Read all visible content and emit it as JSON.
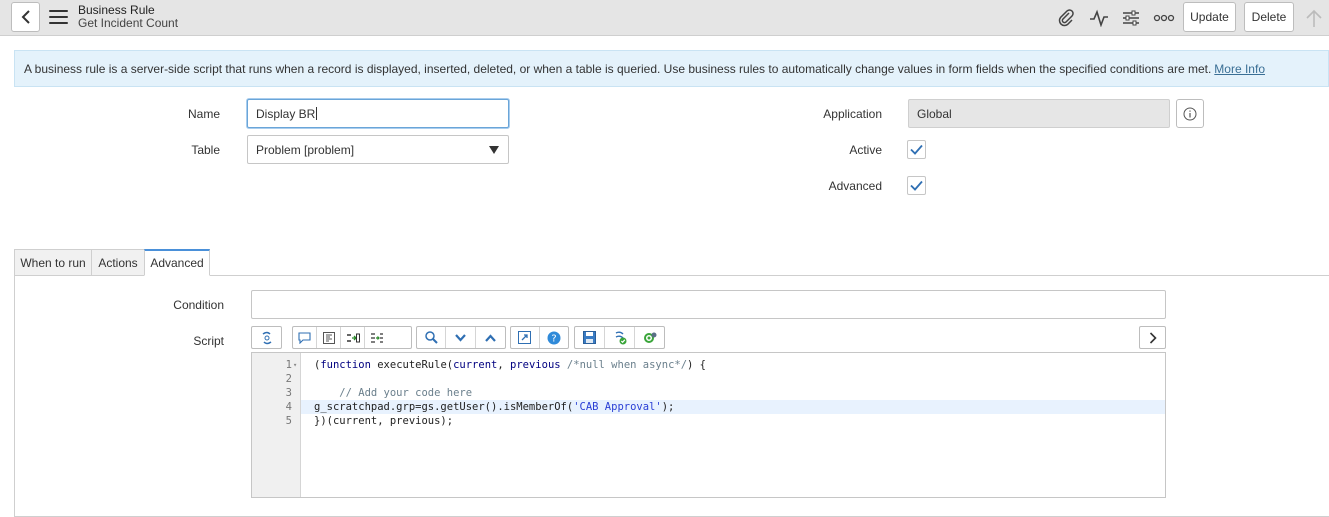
{
  "header": {
    "record_type": "Business Rule",
    "record_name": "Get Incident Count",
    "update_label": "Update",
    "delete_label": "Delete"
  },
  "banner": {
    "text": "A business rule is a server-side script that runs when a record is displayed, inserted, deleted, or when a table is queried. Use business rules to automatically change values in form fields when the specified conditions are met.",
    "link": "More Info"
  },
  "form": {
    "name_label": "Name",
    "name_value": "Display BR",
    "table_label": "Table",
    "table_value": "Problem [problem]",
    "application_label": "Application",
    "application_value": "Global",
    "active_label": "Active",
    "active_checked": true,
    "advanced_label": "Advanced",
    "advanced_checked": true
  },
  "tabs": [
    {
      "label": "When to run",
      "active": false
    },
    {
      "label": "Actions",
      "active": false
    },
    {
      "label": "Advanced",
      "active": true
    }
  ],
  "advanced": {
    "condition_label": "Condition",
    "condition_value": "",
    "script_label": "Script"
  },
  "script": {
    "line_numbers": [
      "1",
      "2",
      "3",
      "4",
      "5"
    ],
    "active_line": 4
  },
  "colors": {
    "tab_accent": "#4a90d9",
    "banner_bg": "#e4f2fb",
    "check": "#2f6fb3"
  }
}
